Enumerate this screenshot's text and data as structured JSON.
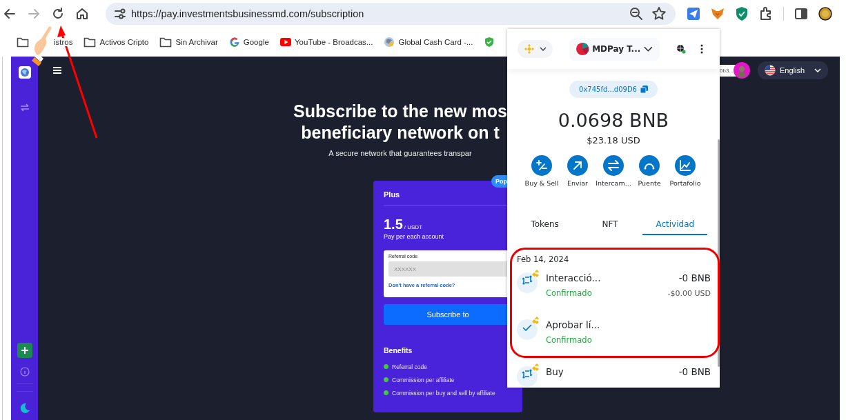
{
  "browser": {
    "url": "https://pay.investmentsbusinessmd.com/subscription",
    "bookmarks": [
      {
        "kind": "folder",
        "label": "istros"
      },
      {
        "kind": "folder",
        "label": "Activos Cripto"
      },
      {
        "kind": "folder",
        "label": "Sin Archivar"
      },
      {
        "kind": "google",
        "label": "Google"
      },
      {
        "kind": "youtube",
        "label": "YouTube - Broadcas..."
      },
      {
        "kind": "globe",
        "label": "Global Cash Card -..."
      },
      {
        "kind": "shield"
      }
    ]
  },
  "page": {
    "header": {
      "address_chip": "0b3...",
      "language": "English"
    },
    "hero": {
      "title_lines": [
        "Subscribe to the new mos",
        "beneficiary network on t"
      ],
      "subtitle": "A secure network that guarantees transpar"
    },
    "plan_card": {
      "badge": "Pop",
      "name": "Plus",
      "price": "1.5",
      "unit": "/ USDT",
      "price_note": "Pay per each account",
      "referral": {
        "label": "Referral code",
        "placeholder": "XXXXXX",
        "link": "Don't have a referral code?"
      },
      "button": "Subscribe to",
      "benefits_title": "Benefits",
      "benefits": [
        "Referral code",
        "Commission per affiliate",
        "Commission per buy and sell by affiliate"
      ]
    }
  },
  "wallet": {
    "account": "MDPay T...",
    "address": "0x745fd...d09D6",
    "balance": "0.0698 BNB",
    "fiat": "$23.18 USD",
    "actions": [
      {
        "kind": "buy",
        "label": "Buy & Sell"
      },
      {
        "kind": "send",
        "label": "Enviar"
      },
      {
        "kind": "swap",
        "label": "Intercam..."
      },
      {
        "kind": "bridge",
        "label": "Puente"
      },
      {
        "kind": "portfolio",
        "label": "Portafolio"
      }
    ],
    "tabs": [
      {
        "label": "Tokens",
        "selected": false
      },
      {
        "label": "NFT",
        "selected": false
      },
      {
        "label": "Actividad",
        "selected": true
      }
    ],
    "activity": {
      "date": "Feb 14, 2024",
      "items": [
        {
          "kind": "swap",
          "title": "Interacció...",
          "status": "Confirmado",
          "amount": "-0 BNB",
          "fiat": "-$0.00 USD"
        },
        {
          "kind": "approve",
          "title": "Aprobar lí...",
          "status": "Confirmado"
        },
        {
          "kind": "swap",
          "title": "Buy",
          "amount": "-0 BNB"
        }
      ]
    }
  }
}
